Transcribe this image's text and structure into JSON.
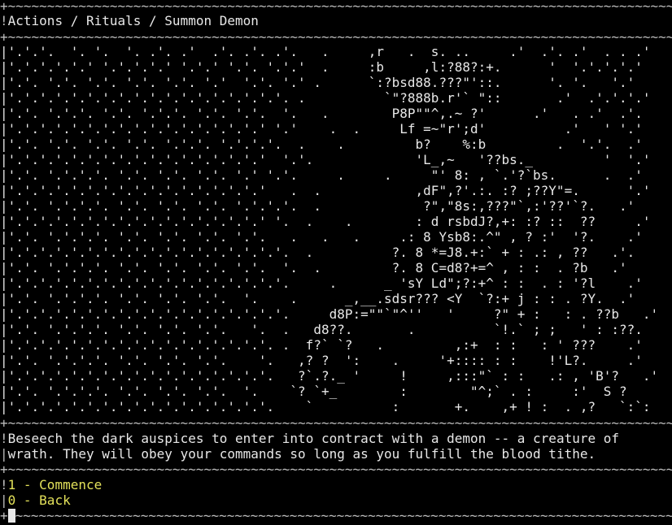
{
  "breadcrumb": "Actions / Rituals / Summon Demon",
  "art_lines": [
    "|'.'.'.  '. '.  '. .'. .'  .'. .'. .'.   .     ,r   .  s. ..     .'  .'. .'  . . .'",
    "|'.'.'.'.'.' '.'.'.'.' '.'.' '.'. '.'.'  .     :b     ,l:?88?:+.      '  '.'.'.'.'",
    "|'.'. '.'. '.'. '.'. '.'. '.'  '.'. '.' .      `:?bsd88.???\"'::.      '. '.   '.'",
    "|'.'.'.'.'.'.'.'.'.'.'.'.'.'.'.'.'.'. .          `\"?888b.r'` \"::       .'  .'.'.'.'",
    "|'.'. '.'.'. '.'. '.'.'. '.'. '.'.  '.   .        P8P\"\"^,.~ ?'      .'   . .'  .'.",
    "|'.'.'.'.'.'.'.'.'.'.'.'.'.'.'.'.' '.'    .  .     Lf =~\"r';d'          .'   ' '.'",
    "|'.'. '.'. '.'. '.'. '.'.'. '.'.'.'.  .    .         b?    %:b         .  '.'.  .'",
    "|'.'.'.'.'.'.'.'.'.'.'.'.'.'.'.'.'  '.'.             'L_,~   '??bs._         '  '.'",
    "|'.'. '.'.'.'. '.'. '.'. '.'. '.' '.'.     .     .     \"' 8: , `.'?`bs.      .  .'",
    "|'.'.'.'.'.'.'.'.'.'.'.'.'.'.'.'.'   .  .            ,dF\",?'.:. :? ;??Y\"=.      '.'",
    "|'.'. '.'.'.'. '.'. '.'. '.'. '.'.'.'.  .             ?\",\"8s:,???\"`,:'??'`?.   .'",
    "|'.'.'.'.'.'.'.'.'.'.'.'.'.'.'.'.' '.  .    .        : d rsbdJ?,+: :? ::  ??     .'",
    "|'.'. '.'.'.'. '.'. '.'. '.'. '.'.   .   .   .     .: 8 Ysb8:.^\" , ? :'  '?.    .'",
    "|'.'.'.'.'.'.'.'.'.'.'.'.'.'.'.'.'.'.  .          ?. 8 *=J8.+:` + : .: , ??   .'.",
    "|'.'. '.'.'.'. '.'. '.'. '.'. '.'.  '.  .         ?. 8 C=d8?+=^ , : :  . ?b   .'",
    "|'.'.'.'.'.'.'.'.'.'.'.'.'.'.'.'.'.'.     .      _ 'sY Ld\";?:+^ : :  . : '?l    .'",
    "|'.'. '.'.'.'. '.'. '.'. '.'.  '.    .      _,__.sdsr??? <Y  `?:+ j : : . ?Y.  .'",
    "|'.'.'.'.'.'.'.'.'.'.'.'.'.'.'.'.'.'.     d8P:=\"\"`\"^''   '     ?\" + :   : . ??b   .'",
    "|'.'. '.'.'.'. '.'. '.'. '.'.   '.  .   d8??.       .          `!.` ; ;   ' : :??.",
    "|'.'.'.'.'.'.'.'.'.'.'.'.'.'.'.'.'. .  f?` `?   .         ,:+  : :   : ' ???    .'",
    "|'.'. '.'.'.'. '.'. '.'. '.'.    '.   ,? ?  ':    .     '+:::: : :    !'L?.     .'",
    "|'.'.'.'.'.'.'.'.'.'.'.'.'.'.'.'.'.   ?`.?._ '     !     ,:::\"` : :   .: , 'B'?   .'",
    "|'.'. '.'.'.'. '.'. '.'. '.'.  '.    `? `+_        :        \"^;` . :     :'  S ?",
    "|'.'.'.'.'.'.'.'.'.'.'.'.'.'.'.'.'.    `          :       +.    ,+ ! :  . ,?   `:`:"
  ],
  "description_lines": [
    "Beseech the dark auspices to enter into contract with a demon -- a creature of",
    "wrath. They will obey your commands so long as you fulfill the blood tithe."
  ],
  "menu": [
    {
      "key": "1",
      "label": "1 - Commence"
    },
    {
      "key": "0",
      "label": "0 - Back"
    }
  ],
  "colors": {
    "background": "#000000",
    "text": "#e8e8e8",
    "border": "#bdbdbd",
    "menu_option": "#e3e15a"
  }
}
